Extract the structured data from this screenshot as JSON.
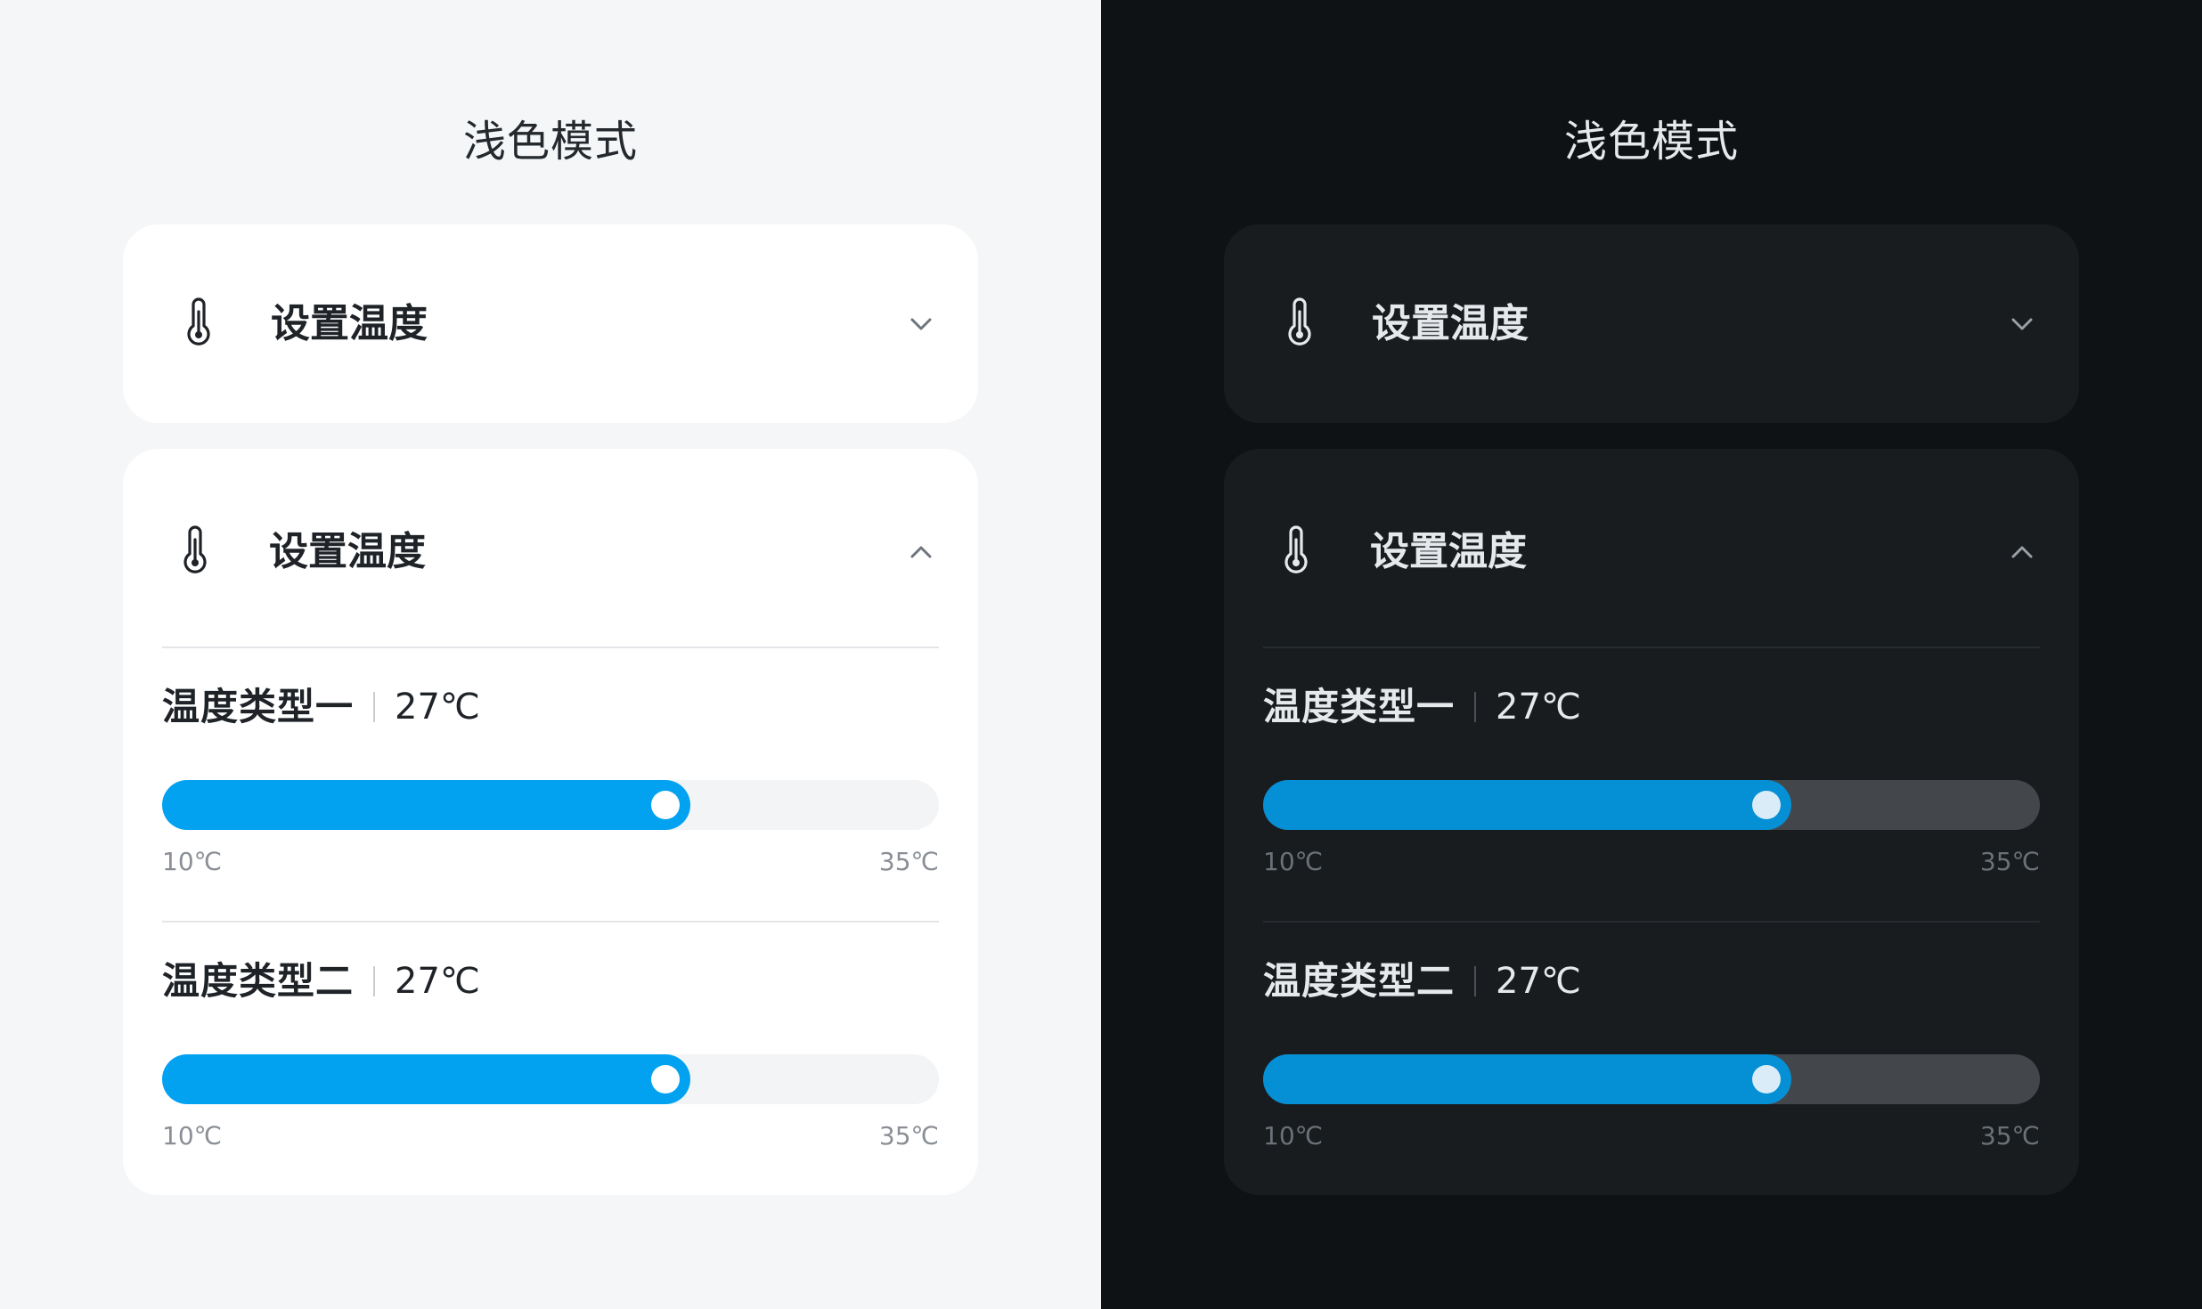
{
  "colors": {
    "light_background": "#f5f6f8",
    "dark_background": "#0e1215",
    "light_card": "#ffffff",
    "dark_card": "#181c1f",
    "accent_light": "#03a2f1",
    "accent_dark": "#058fd4"
  },
  "panels": [
    {
      "theme": "light",
      "title": "浅色模式",
      "collapsed_card": {
        "icon": "thermometer-icon",
        "label": "设置温度",
        "chevron": "chevron-down-icon"
      },
      "expanded_card": {
        "icon": "thermometer-icon",
        "label": "设置温度",
        "chevron": "chevron-up-icon",
        "sliders": [
          {
            "name": "温度类型一",
            "value_text": "27℃",
            "min_text": "10℃",
            "max_text": "35℃",
            "value": 27,
            "min": 10,
            "max": 35
          },
          {
            "name": "温度类型二",
            "value_text": "27℃",
            "min_text": "10℃",
            "max_text": "35℃",
            "value": 27,
            "min": 10,
            "max": 35
          }
        ]
      }
    },
    {
      "theme": "dark",
      "title": "浅色模式",
      "collapsed_card": {
        "icon": "thermometer-icon",
        "label": "设置温度",
        "chevron": "chevron-down-icon"
      },
      "expanded_card": {
        "icon": "thermometer-icon",
        "label": "设置温度",
        "chevron": "chevron-up-icon",
        "sliders": [
          {
            "name": "温度类型一",
            "value_text": "27℃",
            "min_text": "10℃",
            "max_text": "35℃",
            "value": 27,
            "min": 10,
            "max": 35
          },
          {
            "name": "温度类型二",
            "value_text": "27℃",
            "min_text": "10℃",
            "max_text": "35℃",
            "value": 27,
            "min": 10,
            "max": 35
          }
        ]
      }
    }
  ]
}
